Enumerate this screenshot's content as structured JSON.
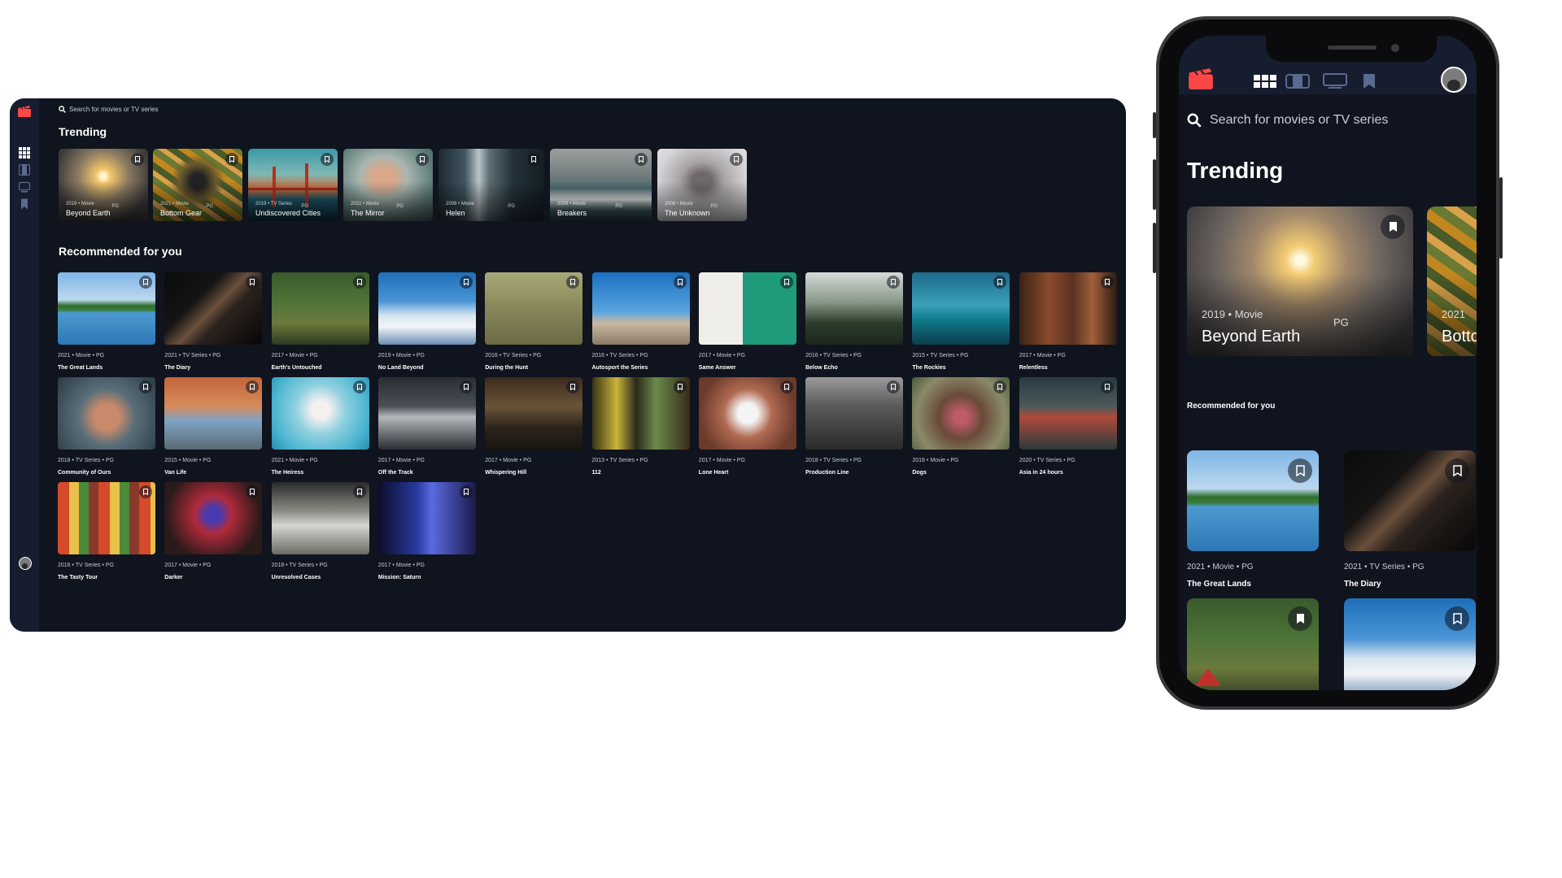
{
  "search": {
    "placeholder": "Search for movies or TV series"
  },
  "sections": {
    "trending": "Trending",
    "recommended": "Recommended for you"
  },
  "dot": "•",
  "colors": {
    "background": "#10141e",
    "sidebar": "#161d2f",
    "accent": "#fc4747",
    "text": "#ffffff"
  },
  "icons": {
    "logo": "movie-clapper-icon",
    "nav": [
      "home-grid-icon",
      "movies-film-icon",
      "tv-series-icon",
      "bookmark-icon"
    ],
    "search": "search-icon",
    "bookmark": "bookmark-icon"
  },
  "trending": [
    {
      "year": "2019",
      "category": "Movie",
      "rating": "PG",
      "title": "Beyond Earth"
    },
    {
      "year": "2021",
      "category": "Movie",
      "rating": "PG",
      "title": "Bottom Gear"
    },
    {
      "year": "2019",
      "category": "TV Series",
      "rating": "PG",
      "title": "Undiscovered Cities"
    },
    {
      "year": "2021",
      "category": "Movie",
      "rating": "PG",
      "title": "The Mirror"
    },
    {
      "year": "2008",
      "category": "Movie",
      "rating": "PG",
      "title": "Helen"
    },
    {
      "year": "2009",
      "category": "Movie",
      "rating": "PG",
      "title": "Breakers"
    },
    {
      "year": "2008",
      "category": "Movie",
      "rating": "PG",
      "title": "The Unknown"
    }
  ],
  "recommended": [
    {
      "year": "2021",
      "category": "Movie",
      "rating": "PG",
      "title": "The Great Lands"
    },
    {
      "year": "2021",
      "category": "TV Series",
      "rating": "PG",
      "title": "The Diary"
    },
    {
      "year": "2017",
      "category": "Movie",
      "rating": "PG",
      "title": "Earth's Untouched"
    },
    {
      "year": "2019",
      "category": "Movie",
      "rating": "PG",
      "title": "No Land Beyond"
    },
    {
      "year": "2016",
      "category": "TV Series",
      "rating": "PG",
      "title": "During the Hunt"
    },
    {
      "year": "2016",
      "category": "TV Series",
      "rating": "PG",
      "title": "Autosport the Series"
    },
    {
      "year": "2017",
      "category": "Movie",
      "rating": "PG",
      "title": "Same Answer"
    },
    {
      "year": "2016",
      "category": "TV Series",
      "rating": "PG",
      "title": "Below Echo"
    },
    {
      "year": "2015",
      "category": "TV Series",
      "rating": "PG",
      "title": "The Rockies"
    },
    {
      "year": "2017",
      "category": "Movie",
      "rating": "PG",
      "title": "Relentless"
    },
    {
      "year": "2018",
      "category": "TV Series",
      "rating": "PG",
      "title": "Community of Ours"
    },
    {
      "year": "2015",
      "category": "Movie",
      "rating": "PG",
      "title": "Van Life"
    },
    {
      "year": "2021",
      "category": "Movie",
      "rating": "PG",
      "title": "The Heiress"
    },
    {
      "year": "2017",
      "category": "Movie",
      "rating": "PG",
      "title": "Off the Track"
    },
    {
      "year": "2017",
      "category": "Movie",
      "rating": "PG",
      "title": "Whispering Hill"
    },
    {
      "year": "2013",
      "category": "TV Series",
      "rating": "PG",
      "title": "112"
    },
    {
      "year": "2017",
      "category": "Movie",
      "rating": "PG",
      "title": "Lone Heart"
    },
    {
      "year": "2018",
      "category": "TV Series",
      "rating": "PG",
      "title": "Production Line"
    },
    {
      "year": "2016",
      "category": "Movie",
      "rating": "PG",
      "title": "Dogs"
    },
    {
      "year": "2020",
      "category": "TV Series",
      "rating": "PG",
      "title": "Asia in 24 hours"
    },
    {
      "year": "2016",
      "category": "TV Series",
      "rating": "PG",
      "title": "The Tasty Tour"
    },
    {
      "year": "2017",
      "category": "Movie",
      "rating": "PG",
      "title": "Darker"
    },
    {
      "year": "2018",
      "category": "TV Series",
      "rating": "PG",
      "title": "Unresolved Cases"
    },
    {
      "year": "2017",
      "category": "Movie",
      "rating": "PG",
      "title": "Mission: Saturn"
    }
  ],
  "mobile": {
    "trending": [
      {
        "year": "2019",
        "category": "Movie",
        "rating": "PG",
        "title": "Beyond Earth"
      },
      {
        "year": "2021",
        "title": "Botto"
      }
    ],
    "recommended": [
      {
        "year": "2021",
        "category": "Movie",
        "rating": "PG",
        "title": "The Great Lands"
      },
      {
        "year": "2021",
        "category": "TV Series",
        "rating": "PG",
        "title": "The Diary"
      },
      {
        "title": ""
      },
      {
        "title": ""
      }
    ]
  }
}
